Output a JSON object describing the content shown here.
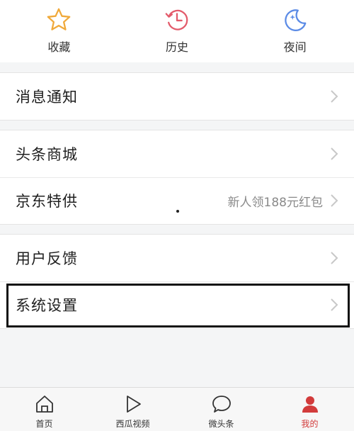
{
  "top_actions": [
    {
      "label": "收藏",
      "icon": "star-icon",
      "color": "#f0a93a"
    },
    {
      "label": "历史",
      "icon": "clock-icon",
      "color": "#e35b6b"
    },
    {
      "label": "夜间",
      "icon": "moon-icon",
      "color": "#5b8be6"
    }
  ],
  "groups": [
    {
      "rows": [
        {
          "title": "消息通知",
          "extra": ""
        }
      ]
    },
    {
      "rows": [
        {
          "title": "头条商城",
          "extra": ""
        },
        {
          "title": "京东特供",
          "extra": "新人领188元红包"
        }
      ]
    },
    {
      "rows": [
        {
          "title": "用户反馈",
          "extra": ""
        },
        {
          "title": "系统设置",
          "extra": ""
        }
      ]
    }
  ],
  "tabs": [
    {
      "label": "首页",
      "icon": "home-icon",
      "active": false
    },
    {
      "label": "西瓜视频",
      "icon": "play-icon",
      "active": false
    },
    {
      "label": "微头条",
      "icon": "chat-bubble-icon",
      "active": false
    },
    {
      "label": "我的",
      "icon": "profile-icon",
      "active": true
    }
  ],
  "colors": {
    "accent": "#d23b3b",
    "chevron": "#c8c8c8"
  }
}
